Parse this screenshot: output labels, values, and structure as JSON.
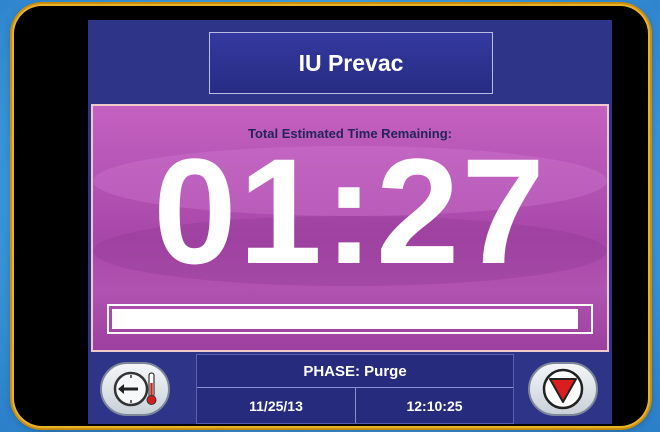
{
  "header": {
    "title": "IU Prevac"
  },
  "status": {
    "label": "Total Estimated Time Remaining:",
    "time_remaining": "01:27",
    "progress_fraction": 0.98
  },
  "footer": {
    "phase_label": "PHASE: Purge",
    "date": "11/25/13",
    "clock": "12:10:25"
  },
  "icons": {
    "left_button": "gauge-thermometer-icon",
    "right_button": "stop-triangle-icon"
  },
  "colors": {
    "screen_background": "#2e3488",
    "status_panel": "#b454b4",
    "bezel_trim": "#e9b227",
    "stop_red": "#d81e1e"
  }
}
